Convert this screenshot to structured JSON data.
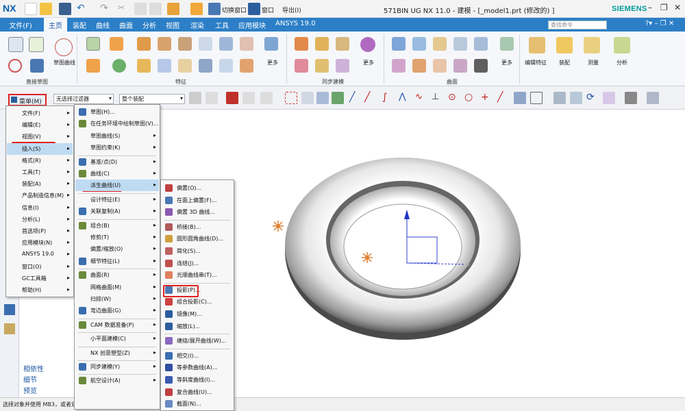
{
  "titlebar": {
    "logo": "NX",
    "switch_window": "切换窗口",
    "window": "窗口",
    "import": "导出(I)",
    "title": "571BIN UG NX 11.0 - 建模 - [_model1.prt  (修改的) ]",
    "brand": "SIEMENS"
  },
  "tabs": [
    "文件(F)",
    "主页",
    "装配",
    "曲线",
    "曲面",
    "分析",
    "视图",
    "渲染",
    "工具",
    "应用模块",
    "ANSYS 19.0"
  ],
  "search_placeholder": "查找命令",
  "ribbon": {
    "sketch_curve": "草图曲线",
    "direct_sketch": "直接草图",
    "feature": "特征",
    "more1": "更多",
    "sync_model": "同步建模",
    "more2": "更多",
    "surface": "曲面",
    "more3": "更多",
    "edit_feature": "编辑特征",
    "assembly": "装配",
    "measure": "测量",
    "analysis": "分析"
  },
  "toolbar": {
    "menu_label": "菜单(M)",
    "filter": "无选择过滤器",
    "scope": "整个装配"
  },
  "main_menu": [
    "文件(F)",
    "编辑(E)",
    "视图(V)",
    "插入(S)",
    "格式(R)",
    "工具(T)",
    "装配(A)",
    "产品制造信息(M)",
    "信息(I)",
    "分析(L)",
    "首选项(P)",
    "应用模块(N)",
    "ANSYS 19.0",
    "窗口(O)",
    "GC工具箱",
    "帮助(H)"
  ],
  "insert_menu": [
    "草图(H)...",
    "在任务环境中绘制草图(V)...",
    "草图曲线(S)",
    "草图约束(K)",
    "基准/点(D)",
    "曲线(C)",
    "派生曲线(U)",
    "设计特征(E)",
    "关联复制(A)",
    "组合(B)",
    "修剪(T)",
    "偏置/缩放(O)",
    "细节特征(L)",
    "曲面(R)",
    "网格曲面(M)",
    "扫掠(W)",
    "弯边曲面(G)",
    "CAM 数据准备(P)",
    "小平面建模(C)",
    "NX 创意塑型(Z)",
    "同步建模(Y)",
    "航空设计(A)"
  ],
  "derived_menu": [
    "偏置(O)...",
    "在面上偏置(F)...",
    "偏置 3D 曲线...",
    "桥接(B)...",
    "圆形圆角曲线(D)...",
    "简化(S)...",
    "连结(J)...",
    "光顺曲线串(T)...",
    "投影(P)...",
    "组合投影(C)...",
    "镜像(M)...",
    "缩放(L)...",
    "缠绕/展开曲线(W)...",
    "相交(I)...",
    "等参数曲线(A)...",
    "等斜度曲线(I)...",
    "复合曲线(U)...",
    "截面(N)..."
  ],
  "nav_tabs": [
    "相依性",
    "细节",
    "预览"
  ],
  "status_text": "选择对象并使用 MB3，或者双",
  "colors": {
    "accent": "#2c7fc7",
    "highlight": "#bfdbf2",
    "callout": "#e02020",
    "brand": "#009999"
  }
}
